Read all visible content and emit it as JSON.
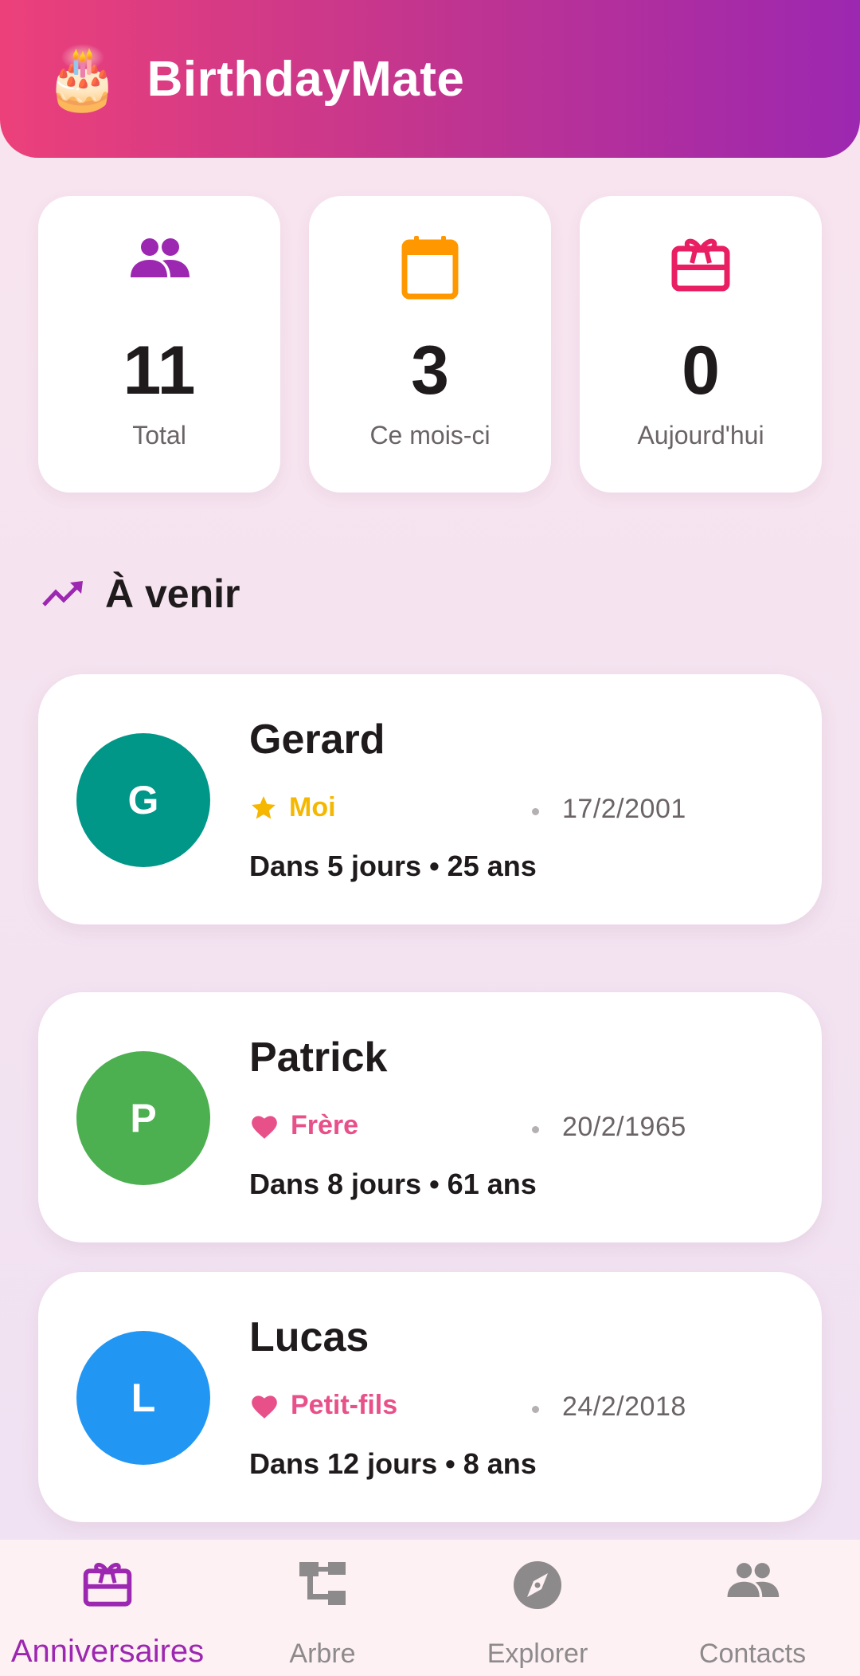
{
  "app": {
    "title": "BirthdayMate",
    "logo_emoji": "🎂"
  },
  "stats": [
    {
      "icon": "people-icon",
      "value": "11",
      "label": "Total",
      "color": "#9c27b0"
    },
    {
      "icon": "calendar-icon",
      "value": "3",
      "label": "Ce mois-ci",
      "color": "#ff9800"
    },
    {
      "icon": "gift-card-icon",
      "value": "0",
      "label": "Aujourd'hui",
      "color": "#e91e63"
    }
  ],
  "section": {
    "title": "À venir",
    "icon": "trending-up-icon",
    "color": "#9c27b0"
  },
  "birthdays": [
    {
      "initial": "G",
      "name": "Gerard",
      "relation": "Moi",
      "relation_icon": "star-icon",
      "relation_color": "#f5b700",
      "date": "17/2/2001",
      "countdown": "Dans 5 jours • 25 ans",
      "avatar_color": "#009688"
    },
    {
      "initial": "P",
      "name": "Patrick",
      "relation": "Frère",
      "relation_icon": "heart-icon",
      "relation_color": "#e8508a",
      "date": "20/2/1965",
      "countdown": "Dans 8 jours • 61 ans",
      "avatar_color": "#4caf50"
    },
    {
      "initial": "L",
      "name": "Lucas",
      "relation": "Petit-fils",
      "relation_icon": "heart-icon",
      "relation_color": "#e8508a",
      "date": "24/2/2018",
      "countdown": "Dans 12 jours • 8 ans",
      "avatar_color": "#2196f3"
    }
  ],
  "nav": [
    {
      "label": "Anniversaires",
      "icon": "gift-card-icon",
      "active": true
    },
    {
      "label": "Arbre",
      "icon": "family-tree-icon",
      "active": false
    },
    {
      "label": "Explorer",
      "icon": "compass-icon",
      "active": false
    },
    {
      "label": "Contacts",
      "icon": "people-icon",
      "active": false
    }
  ],
  "colors": {
    "accent": "#9c27b0",
    "header_start": "#ec407a",
    "header_end": "#9c27b0"
  }
}
